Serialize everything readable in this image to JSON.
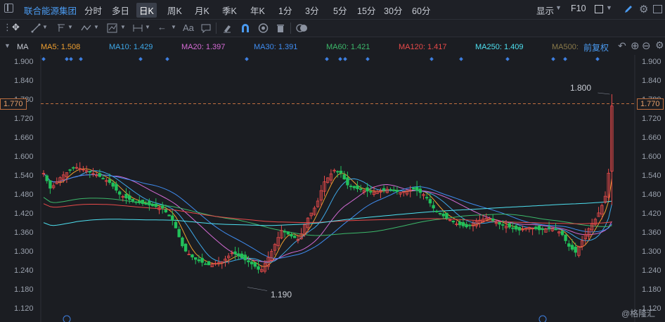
{
  "topbar": {
    "stock_name": "联合能源集团",
    "periods": [
      "分时",
      "多日",
      "日K",
      "周K",
      "月K",
      "季K",
      "年K",
      "1分",
      "3分",
      "5分",
      "15分",
      "30分",
      "60分"
    ],
    "active_period": "日K",
    "display_label": "显示",
    "f10_label": "F10"
  },
  "toolbar": {
    "text_tool_label": "Aa"
  },
  "ma_bar": {
    "label": "MA",
    "items": [
      {
        "text": "MA5: 1.508",
        "color": "#f0a030"
      },
      {
        "text": "MA10: 1.429",
        "color": "#3ea8e8"
      },
      {
        "text": "MA20: 1.397",
        "color": "#d46ad4"
      },
      {
        "text": "MA30: 1.391",
        "color": "#3f8cf0"
      },
      {
        "text": "MA60: 1.421",
        "color": "#3cb86a"
      },
      {
        "text": "MA120: 1.417",
        "color": "#e84a4a"
      },
      {
        "text": "MA250: 1.409",
        "color": "#4ee0f0"
      },
      {
        "text": "MA500:",
        "color": "#8a7a4a"
      }
    ],
    "adjust_label": "前复权"
  },
  "axis": {
    "ticks": [
      "1.900",
      "1.840",
      "1.780",
      "1.720",
      "1.660",
      "1.600",
      "1.540",
      "1.480",
      "1.420",
      "1.360",
      "1.300",
      "1.240",
      "1.180",
      "1.120"
    ],
    "current_price": "1.770"
  },
  "annotations": {
    "high": "1.800",
    "low": "1.190"
  },
  "watermark": "@格隆汇",
  "colors": {
    "up": "#e84a4a",
    "down": "#22c05a",
    "background": "#1b1d22"
  },
  "chart_data": {
    "type": "candlestick",
    "ylim": [
      1.12,
      1.9
    ],
    "ma": [
      {
        "name": "MA5",
        "last": 1.508
      },
      {
        "name": "MA10",
        "last": 1.429
      },
      {
        "name": "MA20",
        "last": 1.397
      },
      {
        "name": "MA30",
        "last": 1.391
      },
      {
        "name": "MA60",
        "last": 1.421
      },
      {
        "name": "MA120",
        "last": 1.417
      },
      {
        "name": "MA250",
        "last": 1.409
      }
    ],
    "max_price": 1.8,
    "min_price": 1.19,
    "last_price": 1.77
  }
}
